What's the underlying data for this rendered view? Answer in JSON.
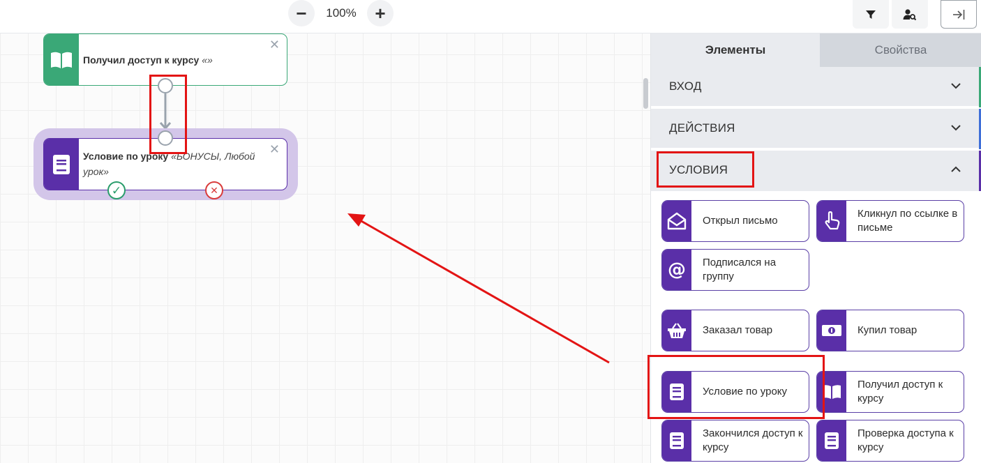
{
  "toolbar": {
    "zoom_out_label": "−",
    "zoom_in_label": "+",
    "zoom_level": "100%",
    "filter_icon": "filter-icon",
    "user_search_icon": "user-search-icon",
    "collapse_icon": "collapse-panel-icon"
  },
  "canvas": {
    "nodes": [
      {
        "title": "Получил доступ к курсу",
        "detail": "«»",
        "icon": "open-book-icon",
        "color": "#3aa877"
      },
      {
        "title": "Условие по уроку",
        "detail": "«БОНУСЫ, Любой урок»",
        "icon": "lesson-book-icon",
        "color": "#5a2fa8",
        "yes_glyph": "✓",
        "no_glyph": "✕"
      }
    ]
  },
  "panel": {
    "tabs": [
      {
        "label": "Элементы",
        "active": true
      },
      {
        "label": "Свойства",
        "active": false
      }
    ],
    "sections": [
      {
        "label": "ВХОД",
        "expanded": false,
        "accent": "#3aa877"
      },
      {
        "label": "ДЕЙСТВИЯ",
        "expanded": false,
        "accent": "#3f6fd8"
      },
      {
        "label": "УСЛОВИЯ",
        "expanded": true,
        "accent": "#5a2fa8"
      }
    ],
    "condition_items": [
      {
        "label": "Открыл письмо",
        "icon": "open-envelope-icon"
      },
      {
        "label": "Кликнул по ссылке в письме",
        "icon": "pointer-hand-icon"
      },
      {
        "label": "Подписался на группу",
        "icon": "at-sign-icon"
      },
      {
        "label": "Заказал товар",
        "icon": "basket-icon"
      },
      {
        "label": "Купил товар",
        "icon": "money-icon"
      },
      {
        "label": "Условие по уроку",
        "icon": "lesson-book-icon"
      },
      {
        "label": "Получил доступ к курсу",
        "icon": "open-book-icon"
      },
      {
        "label": "Закончился доступ к курсу",
        "icon": "lesson-book-icon"
      },
      {
        "label": "Проверка доступа к курсу",
        "icon": "lesson-book-icon"
      }
    ]
  },
  "colors": {
    "highlight": "#e31414",
    "condition_purple": "#5a2fa8",
    "yes_green": "#2a9d6c",
    "no_red": "#d93c3c"
  }
}
